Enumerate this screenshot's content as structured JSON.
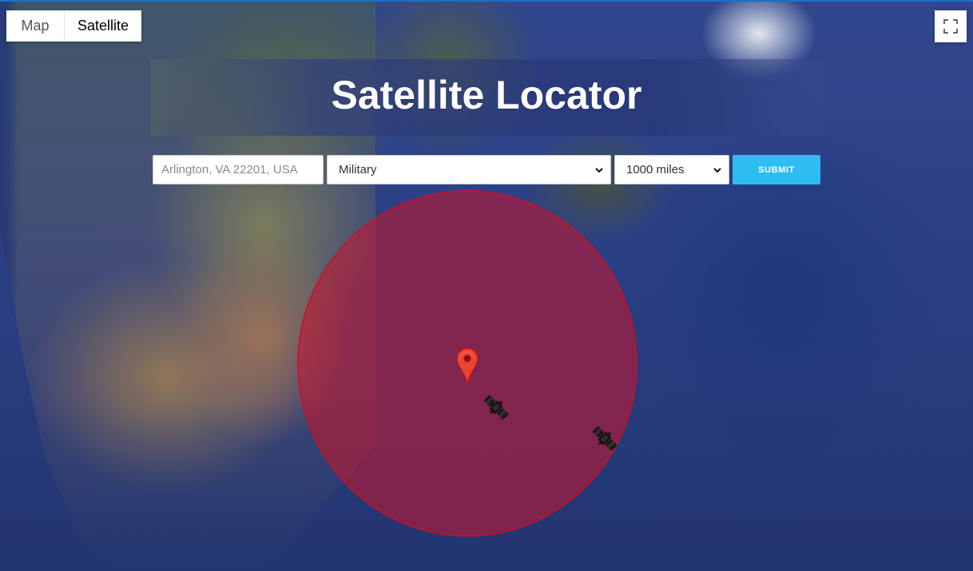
{
  "map": {
    "type_buttons": [
      {
        "label": "Map",
        "active": false
      },
      {
        "label": "Satellite",
        "active": true
      }
    ],
    "fullscreen_icon": "fullscreen-icon",
    "marker_icon": "map-marker-icon",
    "satellite_icon": "satellite-icon",
    "range_circle_color": "#c4162e"
  },
  "header": {
    "title": "Satellite Locator"
  },
  "search": {
    "location_placeholder": "Arlington, VA 22201, USA",
    "category_value": "Military",
    "distance_value": "1000 miles",
    "submit_label": "SUBMIT"
  }
}
